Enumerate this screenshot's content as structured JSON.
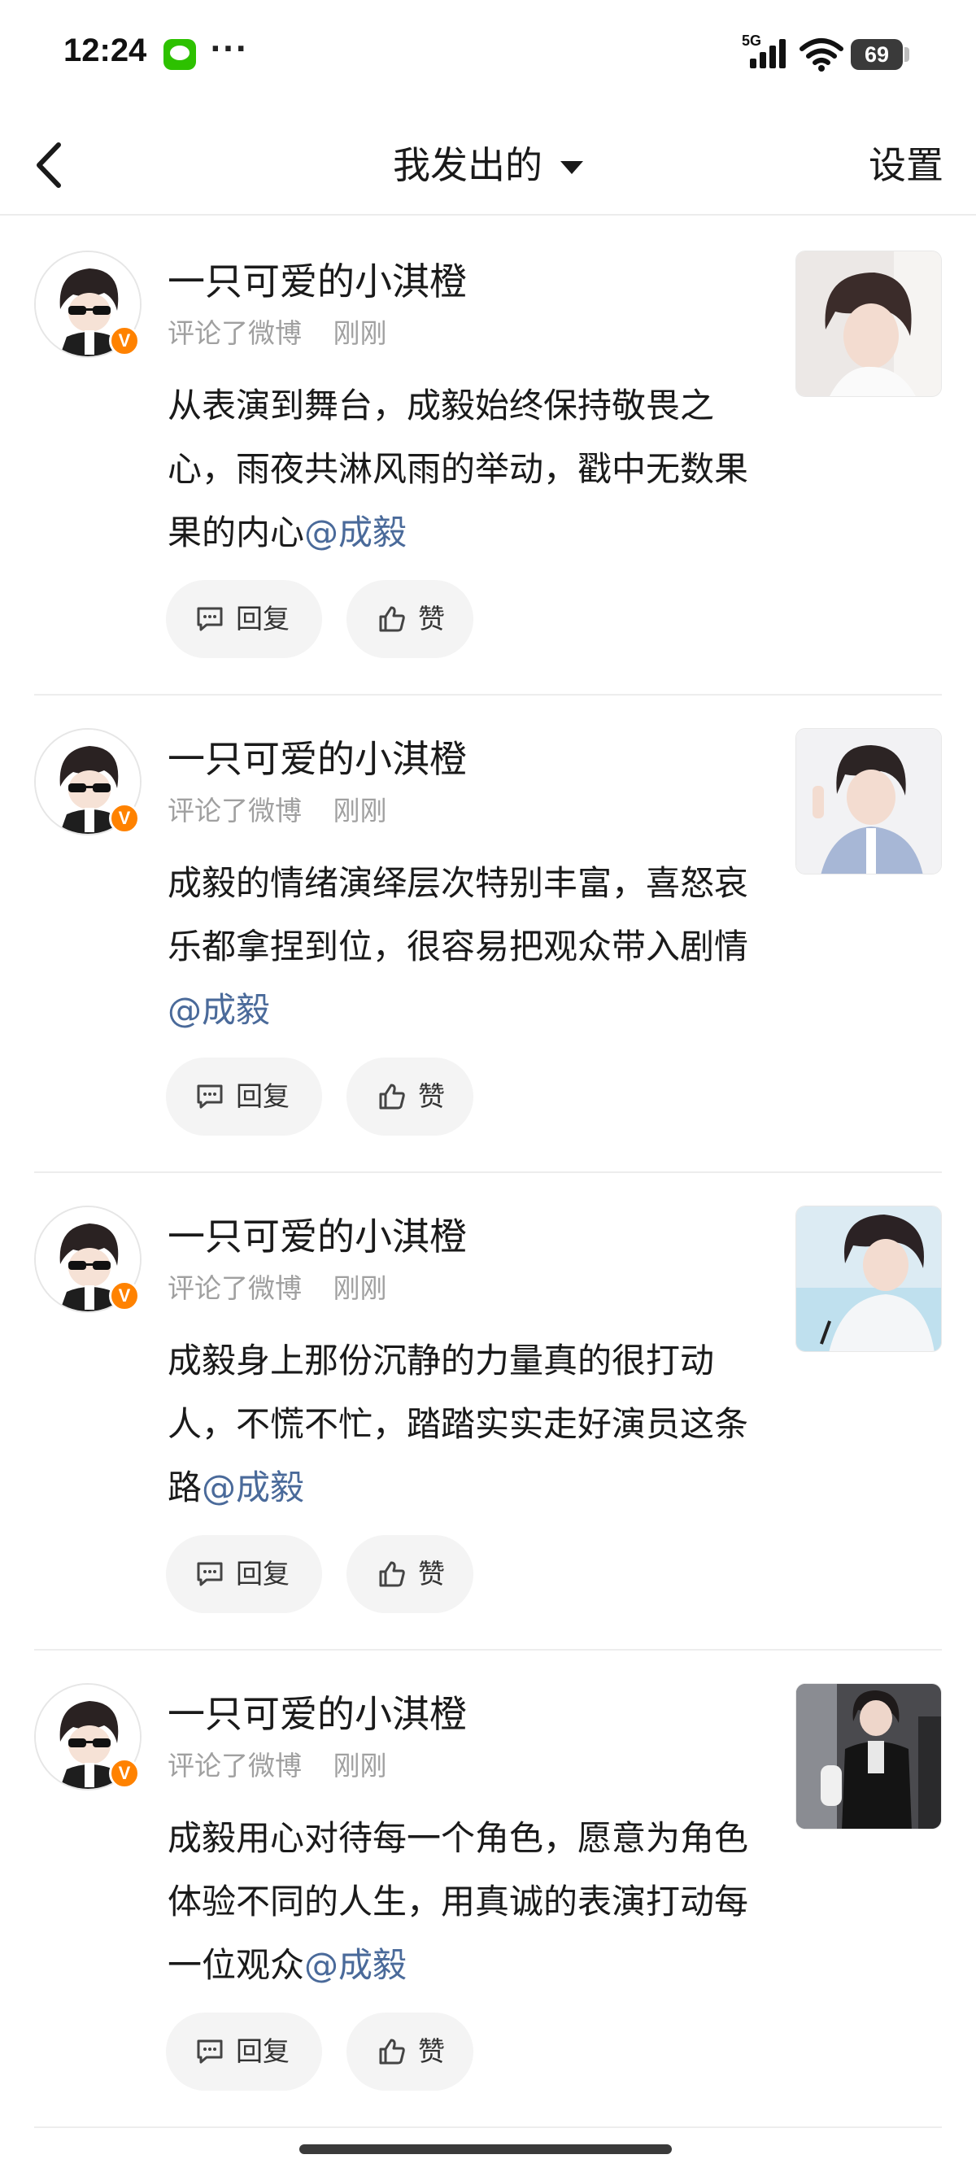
{
  "status_bar": {
    "time": "12:24",
    "more": "···",
    "network": "5G",
    "battery": "69",
    "icons": [
      "wechat-icon",
      "signal-icon",
      "wifi-icon",
      "battery-icon"
    ]
  },
  "nav": {
    "back_icon": "chevron-left-icon",
    "title": "我发出的",
    "title_caret": "caret-down-icon",
    "settings": "设置"
  },
  "items": [
    {
      "username": "一只可爱的小淇橙",
      "action": "评论了微博",
      "time": "刚刚",
      "text": "从表演到舞台，成毅始终保持敬畏之心，雨夜共淋风雨的举动，戳中无数果果的内心",
      "mention": "@成毅",
      "reply_label": "回复",
      "like_label": "赞",
      "badge": "V"
    },
    {
      "username": "一只可爱的小淇橙",
      "action": "评论了微博",
      "time": "刚刚",
      "text": "成毅的情绪演绎层次特别丰富，喜怒哀乐都拿捏到位，很容易把观众带入剧情",
      "mention": "@成毅",
      "reply_label": "回复",
      "like_label": "赞",
      "badge": "V"
    },
    {
      "username": "一只可爱的小淇橙",
      "action": "评论了微博",
      "time": "刚刚",
      "text": "成毅身上那份沉静的力量真的很打动人，不慌不忙，踏踏实实走好演员这条路",
      "mention": "@成毅",
      "reply_label": "回复",
      "like_label": "赞",
      "badge": "V"
    },
    {
      "username": "一只可爱的小淇橙",
      "action": "评论了微博",
      "time": "刚刚",
      "text": "成毅用心对待每一个角色，愿意为角色体验不同的人生，用真诚的表演打动每一位观众",
      "mention": "@成毅",
      "reply_label": "回复",
      "like_label": "赞",
      "badge": "V"
    }
  ],
  "colors": {
    "mention": "#4a6a9a",
    "verified_badge": "#ff8200",
    "meta_text": "#a0a0a0",
    "button_bg": "#f4f4f4"
  }
}
